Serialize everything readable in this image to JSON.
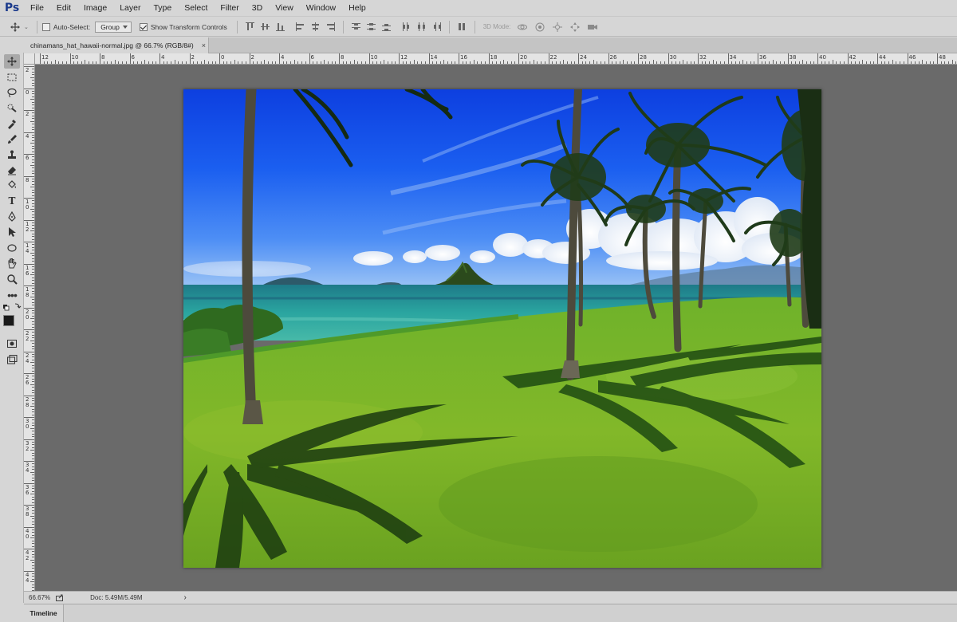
{
  "app": {
    "logo": "Ps"
  },
  "menu": [
    "File",
    "Edit",
    "Image",
    "Layer",
    "Type",
    "Select",
    "Filter",
    "3D",
    "View",
    "Window",
    "Help"
  ],
  "options": {
    "auto_select_label": "Auto-Select:",
    "auto_select_checked": false,
    "auto_select_value": "Group",
    "show_transform_label": "Show Transform Controls",
    "show_transform_checked": true,
    "mode_3d_label": "3D Mode:"
  },
  "document": {
    "tab_title": "chinamans_hat_hawaii-normal.jpg @ 66.7% (RGB/8#)",
    "close_glyph": "×"
  },
  "ruler": {
    "top_labels": [
      "12",
      "10",
      "8",
      "6",
      "4",
      "2",
      "0",
      "2",
      "4",
      "6",
      "8",
      "10",
      "12",
      "14",
      "16",
      "18",
      "20",
      "22",
      "24",
      "26",
      "28",
      "30",
      "32",
      "34",
      "36",
      "38",
      "40",
      "42",
      "44",
      "46",
      "48"
    ],
    "left_labels": [
      "2",
      "0",
      "2",
      "4",
      "6",
      "8",
      "1\n0",
      "1\n2",
      "1\n4",
      "1\n6",
      "1\n8",
      "2\n0",
      "2\n2",
      "2\n4",
      "2\n6",
      "2\n8",
      "3\n0",
      "3\n2",
      "3\n4",
      "3\n6",
      "3\n8",
      "4\n0",
      "4\n2",
      "4\n4"
    ]
  },
  "status": {
    "zoom": "66.67%",
    "doc_info": "Doc: 5.49M/5.49M",
    "arrow": "›"
  },
  "timeline": {
    "label": "Timeline"
  },
  "colors": {
    "foreground": "#1a1a1a",
    "background": "#f3efc0",
    "canvas_bg": "#6a6a6a",
    "ui_bg": "#d6d6d6"
  }
}
